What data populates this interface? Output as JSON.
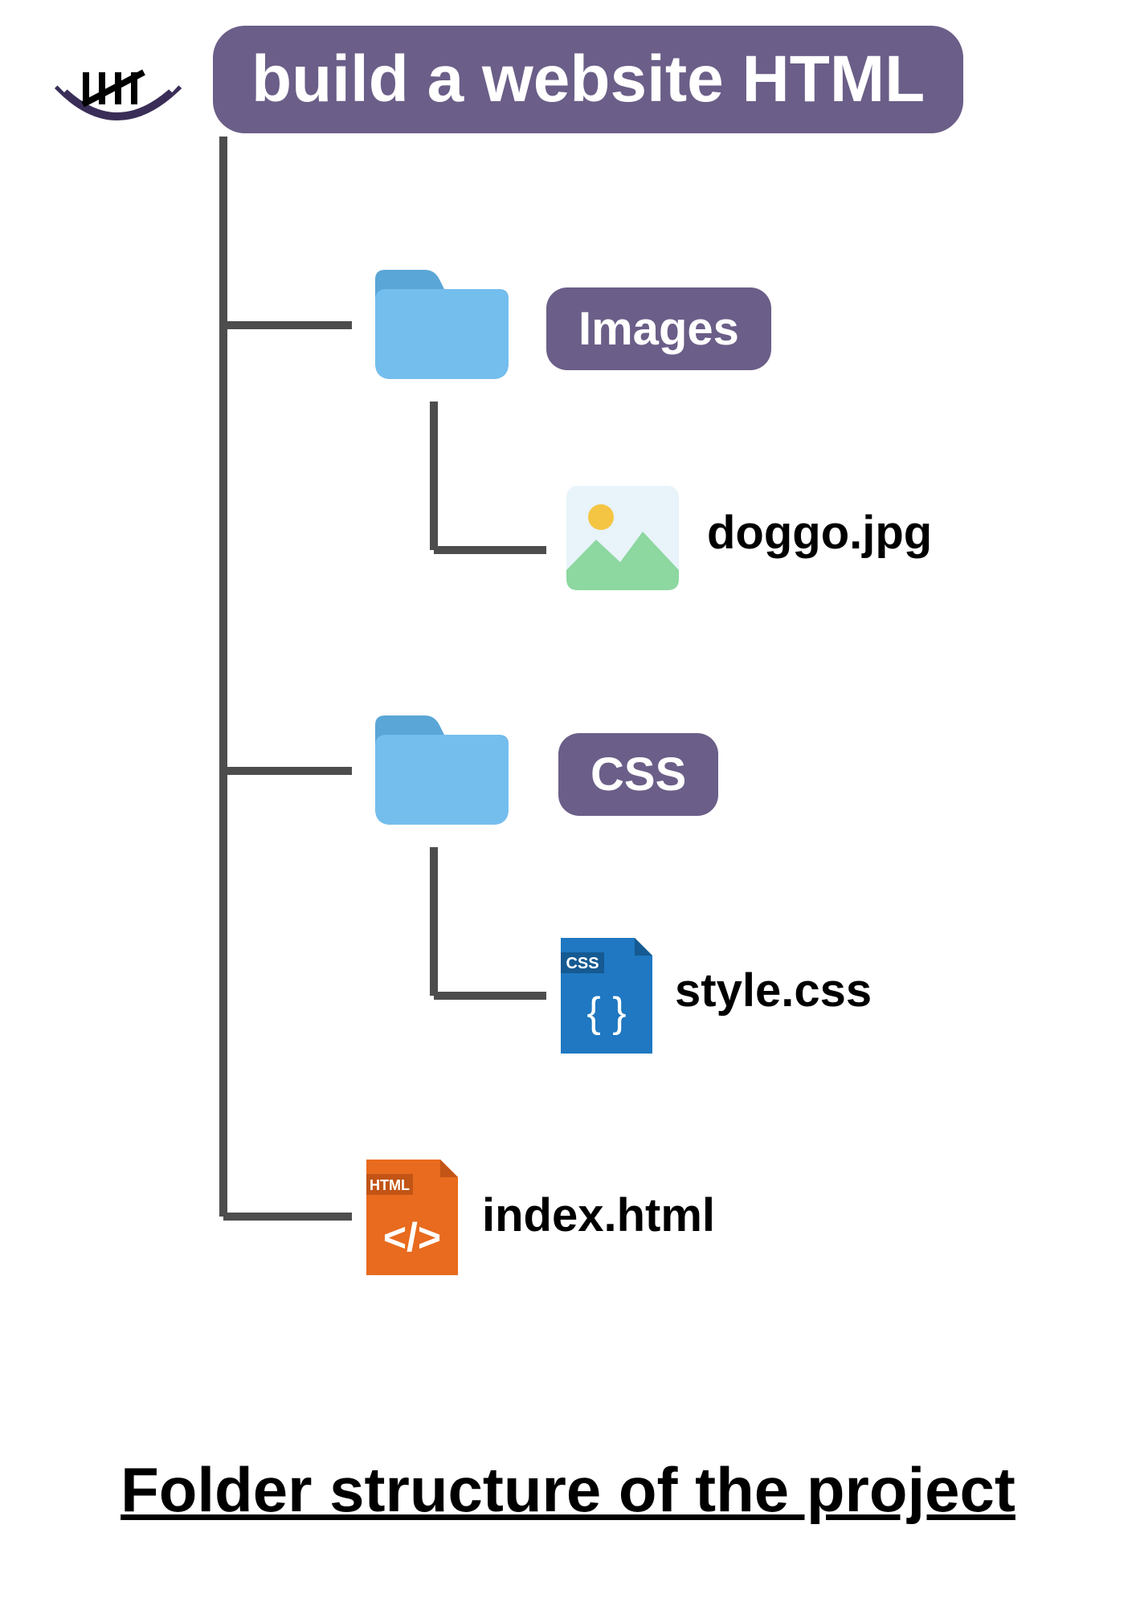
{
  "root_label": "build a website HTML",
  "nodes": {
    "images_folder_label": "Images",
    "doggo_label": "doggo.jpg",
    "css_folder_label": "CSS",
    "style_label": "style.css",
    "index_label": "index.html",
    "css_file_tag": "CSS",
    "html_file_tag": "HTML"
  },
  "caption": "Folder structure of the project",
  "colors": {
    "purple": "#6b5e88",
    "folder_blue": "#74beee",
    "folder_blue_dark": "#5aa6d6",
    "connector": "#4d4d4d",
    "image_sky": "#e8f3fa",
    "image_green": "#8dd7a0",
    "image_sun": "#f4c542",
    "css_blue": "#1f78c1",
    "css_blue_dark": "#155a92",
    "html_orange": "#e86b1f",
    "html_orange_dark": "#c25415"
  }
}
